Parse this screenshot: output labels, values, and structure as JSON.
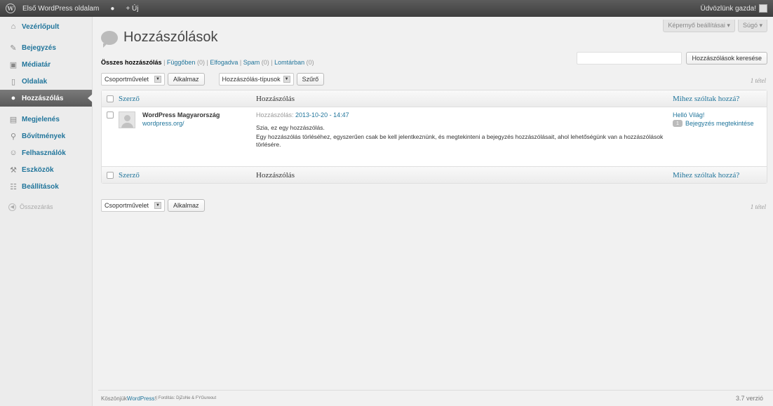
{
  "adminbar": {
    "site_name": "Első WordPress oldalam",
    "new_label": "+ Új",
    "greeting": "Üdvözlünk gazda!"
  },
  "sidebar": {
    "items": [
      {
        "label": "Vezérlőpult",
        "icon": "house-icon",
        "glyph": "⌂"
      },
      {
        "label": "Bejegyzés",
        "icon": "pin-icon",
        "glyph": "✎"
      },
      {
        "label": "Médiatár",
        "icon": "media-icon",
        "glyph": "▣"
      },
      {
        "label": "Oldalak",
        "icon": "page-icon",
        "glyph": "▯"
      },
      {
        "label": "Hozzászólás",
        "icon": "comment-icon",
        "glyph": "●"
      },
      {
        "label": "Megjelenés",
        "icon": "appearance-icon",
        "glyph": "▤"
      },
      {
        "label": "Bővítmények",
        "icon": "plugin-icon",
        "glyph": "⚲"
      },
      {
        "label": "Felhasználók",
        "icon": "users-icon",
        "glyph": "☺"
      },
      {
        "label": "Eszközök",
        "icon": "tools-icon",
        "glyph": "⚒"
      },
      {
        "label": "Beállítások",
        "icon": "settings-icon",
        "glyph": "☷"
      }
    ],
    "collapse_label": "Összezárás"
  },
  "screen_meta": {
    "options_label": "Képernyő beállításai ▾",
    "help_label": "Súgó ▾"
  },
  "page": {
    "title": "Hozzászólások"
  },
  "filters": {
    "all": "Összes hozzászólás",
    "pending": "Függőben",
    "pending_count": "(0)",
    "approved": "Elfogadva",
    "spam": "Spam",
    "spam_count": "(0)",
    "trash": "Lomtárban",
    "trash_count": "(0)"
  },
  "search": {
    "button": "Hozzászólások keresése",
    "value": ""
  },
  "tablenav": {
    "bulk_action": "Csoportművelet",
    "apply": "Alkalmaz",
    "comment_type": "Hozzászólás-típusok",
    "filter": "Szűrő",
    "items_count": "1 tétel"
  },
  "table": {
    "columns": {
      "author": "Szerző",
      "comment": "Hozzászólás",
      "response": "Mihez szóltak hozzá?"
    },
    "rows": [
      {
        "author_name": "WordPress Magyarország",
        "author_url": "wordpress.org/",
        "submitted_prefix": "Hozzászólás: ",
        "submitted_date": "2013-10-20 - 14:47",
        "text_line1": "Szia, ez egy hozzászólás.",
        "text_line2": "Egy hozzászólás törléséhez, egyszerűen csak be kell jelentkeznünk, és megtekinteni a bejegyzés hozzászólásait, ahol lehetőségünk van a hozzászólások törlésére.",
        "response_title": "Helló Világ!",
        "response_count": "1",
        "response_view": "Bejegyzés megtekintése"
      }
    ]
  },
  "footer": {
    "thanks": "Köszönjük ",
    "wp_link": "WordPress",
    "thanks_end": "!",
    "translation": " | Fordítás: DjZoNe & FYGureout",
    "version": "3.7 verzió"
  }
}
